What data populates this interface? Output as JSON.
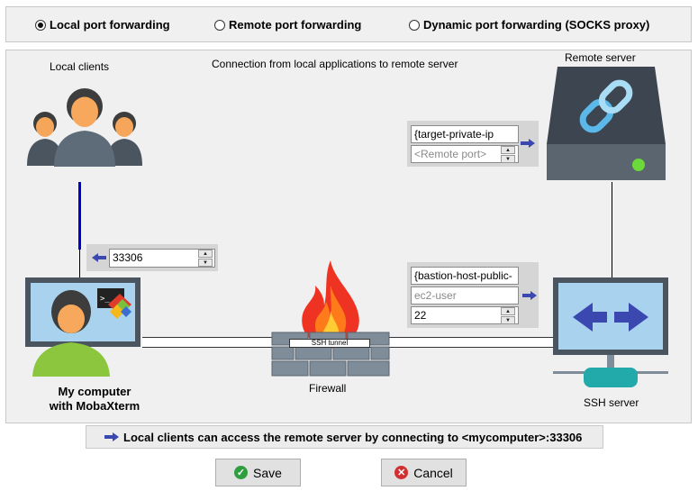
{
  "modes": [
    {
      "label": "Local port forwarding",
      "selected": true
    },
    {
      "label": "Remote port forwarding",
      "selected": false
    },
    {
      "label": "Dynamic port forwarding (SOCKS proxy)",
      "selected": false
    }
  ],
  "diagram": {
    "local_clients_label": "Local clients",
    "connection_caption": "Connection from local applications to remote server",
    "remote_server_label": "Remote server",
    "my_computer_label_line1": "My computer",
    "my_computer_label_line2": "with MobaXterm",
    "firewall_label": "Firewall",
    "ssh_tunnel_label": "SSH tunnel",
    "ssh_server_label": "SSH server"
  },
  "forwarded_port": {
    "value": "33306"
  },
  "remote_target": {
    "host_value": "{target-private-ip",
    "port_placeholder": "<Remote port>"
  },
  "ssh_server": {
    "host_value": "{bastion-host-public-",
    "user_placeholder": "ec2-user",
    "port_value": "22"
  },
  "info_text": "Local clients can access the remote server by connecting to <mycomputer>:33306",
  "buttons": {
    "save": "Save",
    "cancel": "Cancel"
  },
  "colors": {
    "accent_blue": "#3a48b0",
    "tunnel_line": "#0000cc",
    "save_green": "#2e9e3e",
    "cancel_red": "#d23030"
  }
}
